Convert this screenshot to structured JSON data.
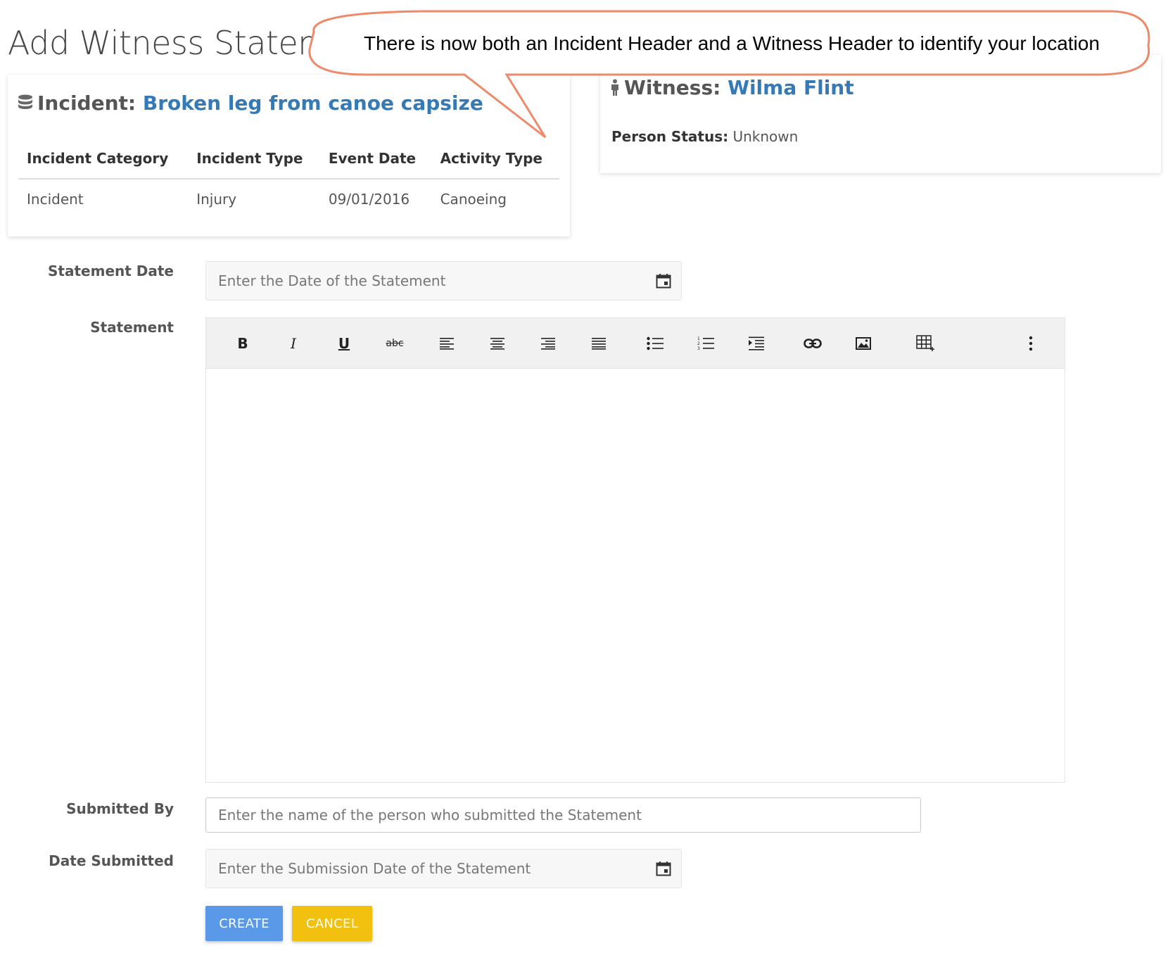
{
  "page": {
    "title": "Add Witness Statement"
  },
  "callout": {
    "text": "There is now both an Incident Header and a Witness Header to identify your location",
    "border_color": "#ee8a6a"
  },
  "incident": {
    "label": "Incident:",
    "name": "Broken leg from canoe capsize",
    "icon": "database-icon",
    "columns": [
      "Incident Category",
      "Incident Type",
      "Event Date",
      "Activity Type"
    ],
    "row": [
      "Incident",
      "Injury",
      "09/01/2016",
      "Canoeing"
    ]
  },
  "witness": {
    "label": "Witness:",
    "name": "Wilma Flint",
    "icon": "person-icon",
    "status_label": "Person Status:",
    "status_value": "Unknown"
  },
  "form": {
    "statement_date": {
      "label": "Statement Date",
      "placeholder": "Enter the Date of the Statement"
    },
    "statement": {
      "label": "Statement"
    },
    "submitted_by": {
      "label": "Submitted By",
      "placeholder": "Enter the name of the person who submitted the Statement"
    },
    "date_submitted": {
      "label": "Date Submitted",
      "placeholder": "Enter the Submission Date of the Statement"
    }
  },
  "toolbar": {
    "bold": "B",
    "italic": "I",
    "underline": "U",
    "strikethrough": "abc"
  },
  "buttons": {
    "create": "CREATE",
    "cancel": "CANCEL"
  },
  "colors": {
    "link": "#337ab7",
    "create": "#5a98e8",
    "cancel": "#f2c10f"
  }
}
